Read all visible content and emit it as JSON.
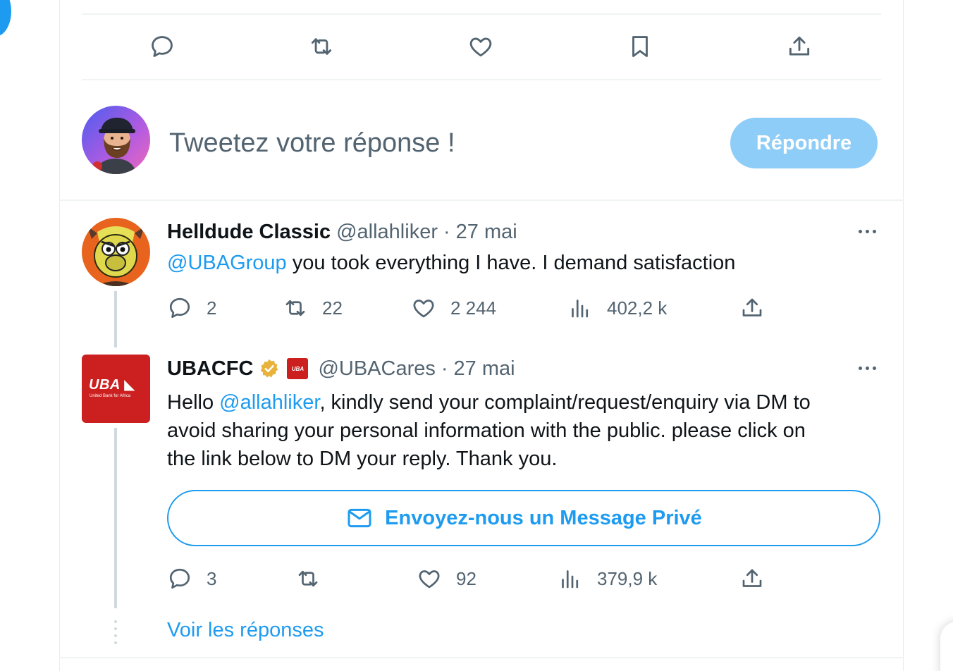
{
  "reply_composer": {
    "placeholder": "Tweetez votre réponse !",
    "reply_button": "Répondre"
  },
  "tweets": [
    {
      "name": "Helldude Classic",
      "handle": "@allahliker",
      "separator": "·",
      "date": "27 mai",
      "mention": "@UBAGroup",
      "text_after": " you took everything I have. I demand satisfaction",
      "replies": "2",
      "retweets": "22",
      "likes": "2 244",
      "views": "402,2 k"
    },
    {
      "name": "UBACFC",
      "handle": "@UBACares",
      "separator": "·",
      "date": "27 mai",
      "verified": true,
      "affiliate_badge_text": "UBA",
      "logo_text": "UBA",
      "logo_subtext": "United Bank for Africa",
      "text_before": "Hello ",
      "mention": "@allahliker",
      "text_line1_after": ", kindly send your complaint/request/enquiry via DM to",
      "text_line2": "avoid sharing your personal information with the public. please click on",
      "text_line3": "the link below to DM your reply. Thank you.",
      "dm_button": "Envoyez-nous un Message Privé",
      "replies": "3",
      "retweets": "",
      "likes": "92",
      "views": "379,9 k"
    }
  ],
  "see_replies": "Voir les réponses",
  "colors": {
    "accent": "#1d9bf0",
    "reply_button_disabled": "#8ecdf8",
    "secondary_text": "#536471",
    "uba_red": "#cc1f1f"
  },
  "icons": [
    "reply-icon",
    "retweet-icon",
    "like-icon",
    "bookmark-icon",
    "share-icon",
    "views-icon",
    "more-icon",
    "verified-icon",
    "mail-icon"
  ]
}
